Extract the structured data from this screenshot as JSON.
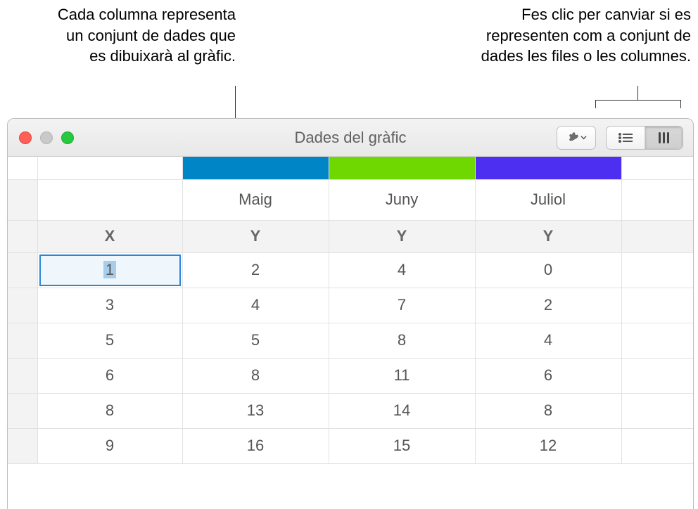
{
  "annotation_left": "Cada columna representa un conjunt de dades que es dibuixarà al gràfic.",
  "annotation_right": "Fes clic per canviar si es representen com a conjunt de dades les files o les columnes.",
  "window_title": "Dades del gràfic",
  "column_colors": [
    "#0085c7",
    "#6fd800",
    "#4c2ff0"
  ],
  "column_labels": [
    "Maig",
    "Juny",
    "Juliol"
  ],
  "axis_headers": [
    "X",
    "Y",
    "Y",
    "Y"
  ],
  "rows": [
    {
      "x": "1",
      "a": "2",
      "b": "4",
      "c": "0"
    },
    {
      "x": "3",
      "a": "4",
      "b": "7",
      "c": "2"
    },
    {
      "x": "5",
      "a": "5",
      "b": "8",
      "c": "4"
    },
    {
      "x": "6",
      "a": "8",
      "b": "11",
      "c": "6"
    },
    {
      "x": "8",
      "a": "13",
      "b": "14",
      "c": "8"
    },
    {
      "x": "9",
      "a": "16",
      "b": "15",
      "c": "12"
    }
  ],
  "chart_data": {
    "type": "table",
    "title": "Dades del gràfic",
    "series": [
      {
        "name": "Maig",
        "x": [
          1,
          3,
          5,
          6,
          8,
          9
        ],
        "y": [
          2,
          4,
          5,
          8,
          13,
          16
        ],
        "color": "#0085c7"
      },
      {
        "name": "Juny",
        "x": [
          1,
          3,
          5,
          6,
          8,
          9
        ],
        "y": [
          4,
          7,
          8,
          11,
          14,
          15
        ],
        "color": "#6fd800"
      },
      {
        "name": "Juliol",
        "x": [
          1,
          3,
          5,
          6,
          8,
          9
        ],
        "y": [
          0,
          2,
          4,
          6,
          8,
          12
        ],
        "color": "#4c2ff0"
      }
    ],
    "xlabel": "X",
    "ylabel": "Y"
  }
}
